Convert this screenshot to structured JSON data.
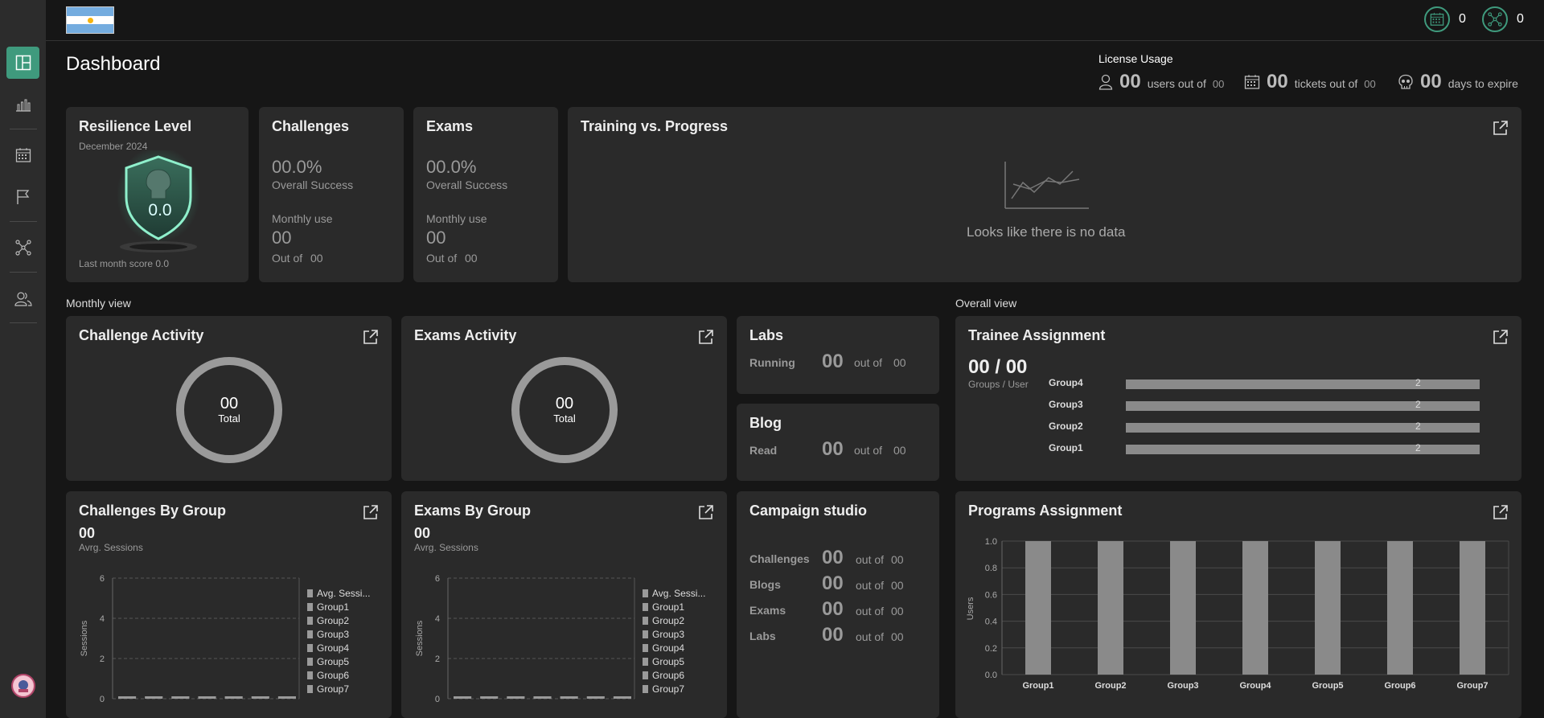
{
  "header": {
    "flag_alt": "Argentina flag",
    "calendar_count": "0",
    "network_count": "0"
  },
  "sidebar": {
    "items": [
      {
        "icon": "dashboard-icon",
        "active": true
      },
      {
        "icon": "bar-chart-icon",
        "active": false
      },
      {
        "icon": "calendar-icon",
        "active": false
      },
      {
        "icon": "flag-icon",
        "active": false
      },
      {
        "icon": "network-icon",
        "active": false
      },
      {
        "icon": "users-icon",
        "active": false
      }
    ]
  },
  "page": {
    "title": "Dashboard"
  },
  "license": {
    "title": "License Usage",
    "users_count": "00",
    "users_label": "users out of",
    "users_total": "00",
    "tickets_count": "00",
    "tickets_label": "tickets out of",
    "tickets_total": "00",
    "days_count": "00",
    "days_label": "days to expire"
  },
  "resilience": {
    "title": "Resilience Level",
    "date": "December 2024",
    "score": "0.0",
    "last_month": "Last month score 0.0"
  },
  "challenges": {
    "title": "Challenges",
    "pct": "00.0%",
    "pct_label": "Overall Success",
    "monthly_label": "Monthly use",
    "monthly_value": "00",
    "outof_label": "Out of",
    "outof_value": "00"
  },
  "exams": {
    "title": "Exams",
    "pct": "00.0%",
    "pct_label": "Overall Success",
    "monthly_label": "Monthly use",
    "monthly_value": "00",
    "outof_label": "Out of",
    "outof_value": "00"
  },
  "training": {
    "title": "Training vs. Progress",
    "nodata": "Looks like there is no data"
  },
  "sections": {
    "monthly": "Monthly view",
    "overall": "Overall view"
  },
  "challenge_activity": {
    "title": "Challenge Activity",
    "value": "00",
    "label": "Total"
  },
  "exams_activity": {
    "title": "Exams Activity",
    "value": "00",
    "label": "Total"
  },
  "labs": {
    "title": "Labs",
    "row_label": "Running",
    "value": "00",
    "outof": "out of",
    "total": "00"
  },
  "blog": {
    "title": "Blog",
    "row_label": "Read",
    "value": "00",
    "outof": "out of",
    "total": "00"
  },
  "campaign": {
    "title": "Campaign studio",
    "rows": [
      {
        "label": "Challenges",
        "value": "00",
        "outof": "out of",
        "total": "00"
      },
      {
        "label": "Blogs",
        "value": "00",
        "outof": "out of",
        "total": "00"
      },
      {
        "label": "Exams",
        "value": "00",
        "outof": "out of",
        "total": "00"
      },
      {
        "label": "Labs",
        "value": "00",
        "outof": "out of",
        "total": "00"
      }
    ]
  },
  "trainee": {
    "title": "Trainee Assignment",
    "value": "00 / 00",
    "sub": "Groups / User"
  },
  "challenges_group": {
    "title": "Challenges By Group",
    "value": "00",
    "sub": "Avrg. Sessions"
  },
  "exams_group": {
    "title": "Exams By Group",
    "value": "00",
    "sub": "Avrg. Sessions"
  },
  "programs": {
    "title": "Programs Assignment"
  },
  "chart_data": [
    {
      "type": "bar",
      "orientation": "horizontal",
      "title": "Trainee Assignment",
      "categories": [
        "Group4",
        "Group3",
        "Group2",
        "Group1"
      ],
      "values": [
        2,
        2,
        2,
        2
      ]
    },
    {
      "type": "bar",
      "title": "Challenges By Group",
      "ylabel": "Sessions",
      "ylim": [
        0,
        6
      ],
      "yticks": [
        0,
        2,
        4,
        6
      ],
      "categories": [
        "Group1",
        "Group2",
        "Group3",
        "Group4",
        "Group5",
        "Group6",
        "Group7"
      ],
      "legend": [
        "Avg. Sessi...",
        "Group1",
        "Group2",
        "Group3",
        "Group4",
        "Group5",
        "Group6",
        "Group7"
      ],
      "legend_position": "right",
      "values": [
        0,
        0,
        0,
        0,
        0,
        0,
        0
      ]
    },
    {
      "type": "bar",
      "title": "Exams By Group",
      "ylabel": "Sessions",
      "ylim": [
        0,
        6
      ],
      "yticks": [
        0,
        2,
        4,
        6
      ],
      "categories": [
        "Group1",
        "Group2",
        "Group3",
        "Group4",
        "Group5",
        "Group6",
        "Group7"
      ],
      "legend": [
        "Avg. Sessi...",
        "Group1",
        "Group2",
        "Group3",
        "Group4",
        "Group5",
        "Group6",
        "Group7"
      ],
      "legend_position": "right",
      "values": [
        0,
        0,
        0,
        0,
        0,
        0,
        0
      ]
    },
    {
      "type": "bar",
      "title": "Programs Assignment",
      "ylabel": "Users",
      "ylim": [
        0,
        1
      ],
      "yticks": [
        0.0,
        0.2,
        0.4,
        0.6,
        0.8,
        1.0
      ],
      "categories": [
        "Group1",
        "Group2",
        "Group3",
        "Group4",
        "Group5",
        "Group6",
        "Group7"
      ],
      "values": [
        1,
        1,
        1,
        1,
        1,
        1,
        1
      ]
    }
  ]
}
